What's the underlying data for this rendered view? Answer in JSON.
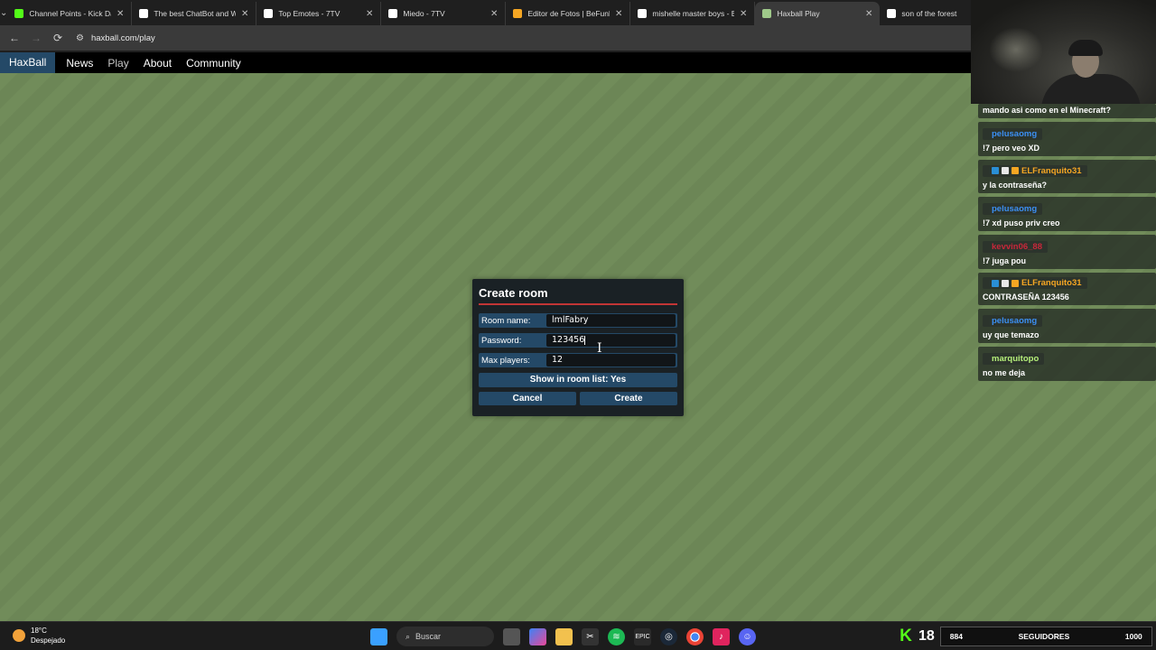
{
  "browser": {
    "tabs": [
      {
        "title": "Channel Points - Kick Das",
        "favicon": "kick-icon",
        "color": "#53fc18",
        "active": false
      },
      {
        "title": "The best ChatBot and Wi",
        "favicon": "diamond-icon",
        "color": "#ffffff",
        "active": false
      },
      {
        "title": "Top Emotes - 7TV",
        "favicon": "7tv-icon",
        "color": "#ffffff",
        "active": false
      },
      {
        "title": "Miedo - 7TV",
        "favicon": "7tv-icon",
        "color": "#ffffff",
        "active": false
      },
      {
        "title": "Editor de Fotos | BeFunky",
        "favicon": "befunky-icon",
        "color": "#f5a623",
        "active": false
      },
      {
        "title": "mishelle master boys - Bu",
        "favicon": "google-icon",
        "color": "#ffffff",
        "active": false
      },
      {
        "title": "Haxball Play",
        "favicon": "haxball-icon",
        "color": "#9fc98a",
        "active": true
      },
      {
        "title": "son of the forest",
        "favicon": "google-icon",
        "color": "#ffffff",
        "active": false
      }
    ],
    "url": "haxball.com/play"
  },
  "site_nav": {
    "brand": "HaxBall",
    "links": [
      "News",
      "Play",
      "About",
      "Community"
    ],
    "active_link": "Play"
  },
  "dialog": {
    "title": "Create room",
    "room_name_label": "Room name:",
    "room_name_value": "lmlFabry",
    "password_label": "Password:",
    "password_value": "123456",
    "max_players_label": "Max players:",
    "max_players_value": "12",
    "show_in_list": "Show in room list: Yes",
    "cancel_label": "Cancel",
    "create_label": "Create"
  },
  "chat": {
    "messages": [
      {
        "user": "",
        "text": "mando asi como en el Minecraft?"
      },
      {
        "user": "pelusaomg",
        "color": "#3b8ff3",
        "badges": false,
        "text": "!7 pero veo XD"
      },
      {
        "user": "ELFranquito31",
        "color": "#f5a623",
        "badges": true,
        "text": "y la contraseña?"
      },
      {
        "user": "pelusaomg",
        "color": "#3b8ff3",
        "badges": false,
        "text": "!7 xd puso priv creo"
      },
      {
        "user": "kevvin06_88",
        "color": "#c8273a",
        "badges": false,
        "text": "!7 juga pou"
      },
      {
        "user": "ELFranquito31",
        "color": "#f5a623",
        "badges": true,
        "text": "CONTRASEÑA 123456"
      },
      {
        "user": "pelusaomg",
        "color": "#3b8ff3",
        "badges": false,
        "text": "uy que temazo"
      },
      {
        "user": "marquitopo",
        "color": "#b6f07a",
        "badges": false,
        "text": "no me deja"
      }
    ]
  },
  "taskbar": {
    "temperature": "18°C",
    "condition": "Despejado",
    "search_placeholder": "Buscar",
    "kick_count": "18",
    "followers_count": "884",
    "followers_label": "SEGUIDORES",
    "followers_goal": "1000"
  },
  "colors": {
    "field": "#718c5a",
    "dialog_bg": "#1a2125",
    "row_blue": "#244967",
    "accent_red": "#c13535"
  }
}
